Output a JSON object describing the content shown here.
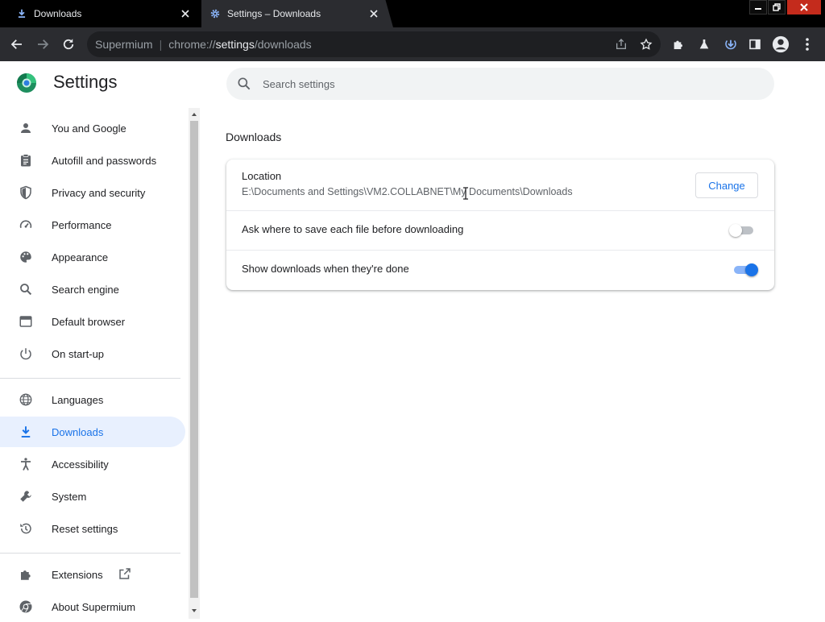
{
  "window": {
    "tabs": [
      {
        "title": "Downloads",
        "active": false
      },
      {
        "title": "Settings – Downloads",
        "active": true
      }
    ]
  },
  "toolbar": {
    "brand": "Supermium",
    "separator": "|",
    "url_scheme": "chrome://",
    "url_host": "settings",
    "url_path": "/downloads"
  },
  "header": {
    "title": "Settings",
    "search_placeholder": "Search settings"
  },
  "sidebar": {
    "items": [
      {
        "label": "You and Google",
        "icon": "person-icon"
      },
      {
        "label": "Autofill and passwords",
        "icon": "clipboard-icon"
      },
      {
        "label": "Privacy and security",
        "icon": "shield-icon"
      },
      {
        "label": "Performance",
        "icon": "speedometer-icon"
      },
      {
        "label": "Appearance",
        "icon": "palette-icon"
      },
      {
        "label": "Search engine",
        "icon": "search-icon"
      },
      {
        "label": "Default browser",
        "icon": "browser-window-icon"
      },
      {
        "label": "On start-up",
        "icon": "power-icon"
      },
      {
        "label": "Languages",
        "icon": "globe-icon"
      },
      {
        "label": "Downloads",
        "icon": "download-icon",
        "active": true
      },
      {
        "label": "Accessibility",
        "icon": "accessibility-icon"
      },
      {
        "label": "System",
        "icon": "wrench-icon"
      },
      {
        "label": "Reset settings",
        "icon": "history-icon"
      },
      {
        "label": "Extensions",
        "icon": "puzzle-icon"
      },
      {
        "label": "About Supermium",
        "icon": "supermium-logo-icon"
      }
    ]
  },
  "main": {
    "section_title": "Downloads",
    "location_label": "Location",
    "location_path": "E:\\Documents and Settings\\VM2.COLLABNET\\My Documents\\Downloads",
    "change_label": "Change",
    "ask_where_label": "Ask where to save each file before downloading",
    "ask_where_enabled": false,
    "show_downloads_label": "Show downloads when they're done",
    "show_downloads_enabled": true
  },
  "colors": {
    "accent": "#1a73e8",
    "active_nav_bg": "#e8f0fe",
    "toolbar_bg": "#2b2c30"
  }
}
